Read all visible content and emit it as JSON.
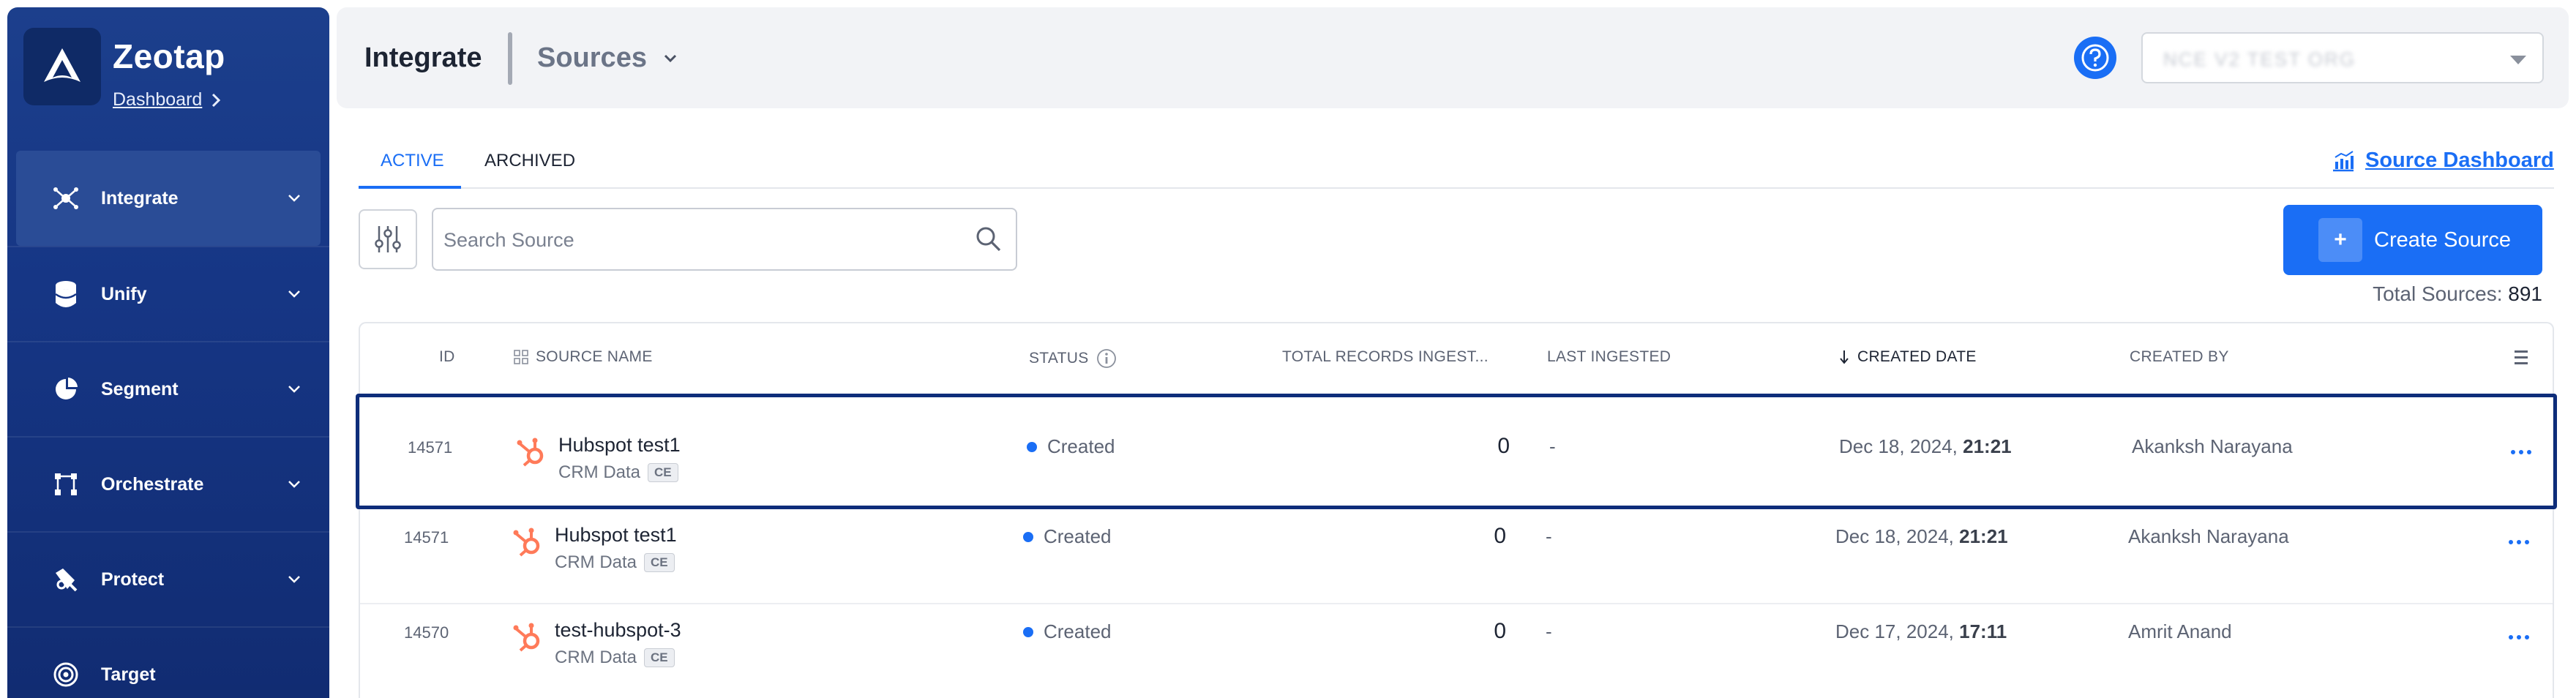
{
  "brand": {
    "name": "Zeotap",
    "dashboard_link": "Dashboard"
  },
  "sidebar": {
    "items": [
      {
        "label": "Integrate",
        "icon": "integrate-icon",
        "active": true
      },
      {
        "label": "Unify",
        "icon": "database-icon"
      },
      {
        "label": "Segment",
        "icon": "pie-chart-icon"
      },
      {
        "label": "Orchestrate",
        "icon": "orchestrate-icon"
      },
      {
        "label": "Protect",
        "icon": "shield-icon"
      },
      {
        "label": "Target",
        "icon": "target-icon"
      }
    ]
  },
  "header": {
    "title": "Integrate",
    "section": "Sources",
    "org_value": "NCE V2 TEST ORG"
  },
  "tabs": {
    "active": "ACTIVE",
    "archived": "ARCHIVED"
  },
  "source_dashboard_link": "Source Dashboard",
  "search": {
    "placeholder": "Search Source"
  },
  "create_button": {
    "plus": "+",
    "label": "Create Source"
  },
  "totals": {
    "label": "Total Sources:",
    "value": "891"
  },
  "table": {
    "columns": {
      "id": "ID",
      "source_name": "SOURCE NAME",
      "status": "STATUS",
      "total_records": "TOTAL RECORDS INGEST...",
      "last_ingested": "LAST INGESTED",
      "created_date": "CREATED DATE",
      "created_by": "CREATED BY"
    },
    "rows": [
      {
        "id": "14571",
        "name": "Hubspot test1",
        "category": "CRM Data",
        "tag": "CE",
        "status": "Created",
        "records": "0",
        "last_ingested": "-",
        "date": "Dec 18, 2024,",
        "time": "21:21",
        "created_by": "Akanksh Narayana"
      },
      {
        "id": "14571",
        "name": "Hubspot test1",
        "category": "CRM Data",
        "tag": "CE",
        "status": "Created",
        "records": "0",
        "last_ingested": "-",
        "date": "Dec 18, 2024,",
        "time": "21:21",
        "created_by": "Akanksh Narayana"
      },
      {
        "id": "14570",
        "name": "test-hubspot-3",
        "category": "CRM Data",
        "tag": "CE",
        "status": "Created",
        "records": "0",
        "last_ingested": "-",
        "date": "Dec 17, 2024,",
        "time": "17:11",
        "created_by": "Amrit Anand"
      }
    ]
  },
  "colors": {
    "primary": "#1a6ef5",
    "sidebar": "#163685",
    "hubspot": "#ff7a59",
    "selection": "#0e2d7a"
  }
}
